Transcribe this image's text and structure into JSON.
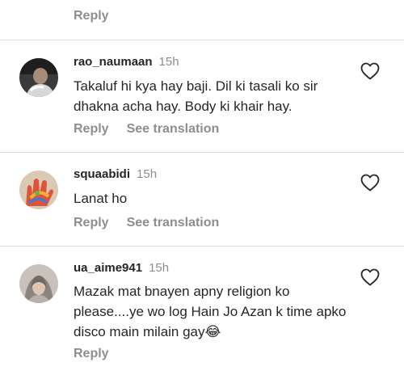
{
  "top": {
    "reply_label": "Reply"
  },
  "comments": [
    {
      "username": "rao_naumaan",
      "time": "15h",
      "text": "Takaluf hi kya hay baji. Dil ki tasali ko sir dhakna acha hay. Body ki khair hay.",
      "reply_label": "Reply",
      "translate_label": "See translation"
    },
    {
      "username": "squaabidi",
      "time": "15h",
      "text": "Lanat ho",
      "reply_label": "Reply",
      "translate_label": "See translation"
    },
    {
      "username": "ua_aime941",
      "time": "15h",
      "text": "Mazak mat bnayen apny  religion ko please....ye wo log Hain Jo Azan k time apko disco main milain gay😂",
      "reply_label": "Reply"
    }
  ],
  "icons": {
    "like": "heart-outline-icon"
  },
  "colors": {
    "text_primary": "#262626",
    "text_secondary": "#8e8e8e",
    "divider": "#dbdbdb"
  }
}
